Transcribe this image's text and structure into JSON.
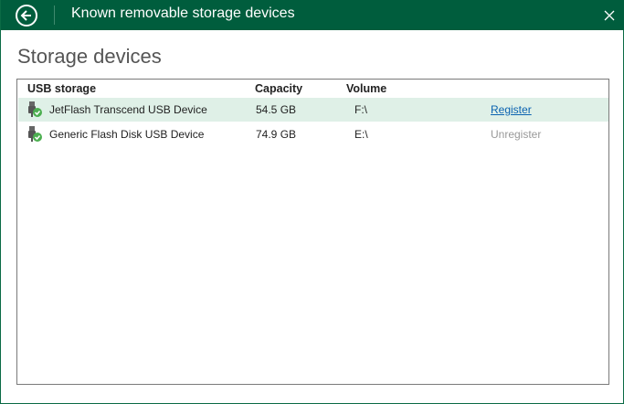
{
  "window": {
    "title": "Known removable storage devices"
  },
  "section_title": "Storage devices",
  "table": {
    "headers": {
      "name": "USB storage",
      "capacity": "Capacity",
      "volume": "Volume"
    },
    "rows": [
      {
        "name": "JetFlash Transcend USB Device",
        "capacity": "54.5 GB",
        "volume": "F:\\",
        "action": "Register",
        "selected": true
      },
      {
        "name": "Generic Flash Disk USB Device",
        "capacity": "74.9 GB",
        "volume": "E:\\",
        "action": "Unregister",
        "selected": false
      }
    ]
  },
  "colors": {
    "titlebar": "#005d3d",
    "selected_row": "#dff0e7",
    "link": "#0a62b0"
  }
}
